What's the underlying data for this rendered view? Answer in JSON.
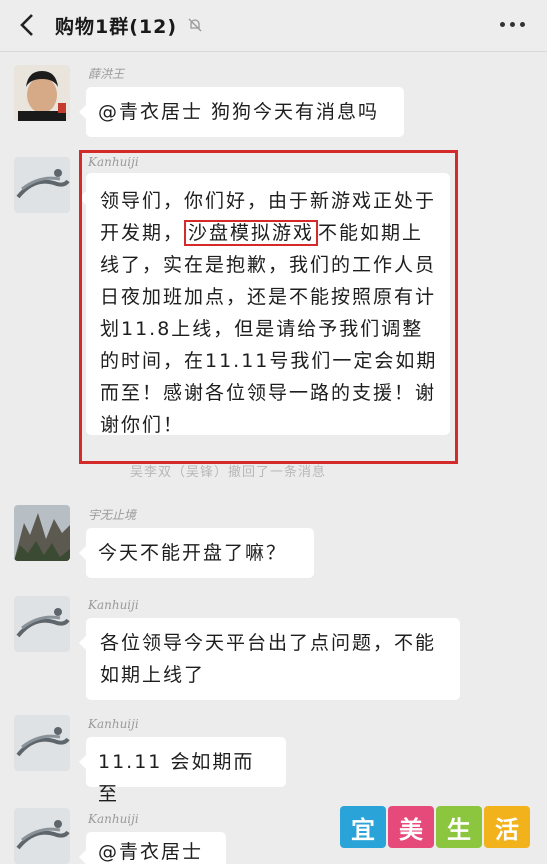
{
  "header": {
    "title": "购物1群(12)",
    "back_icon": "chevron-left-icon",
    "mute_icon": "bell-off-icon",
    "more_icon": "ellipsis-icon"
  },
  "messages": [
    {
      "sender": "薛洪王",
      "text": "@青衣居士 狗狗今天有消息吗"
    },
    {
      "sender": "Kanhuiji",
      "text_before": "领导们，你们好，由于新游戏正处于开发期，",
      "text_highlight": "沙盘模拟游戏",
      "text_after": "不能如期上线了，实在是抱歉，我们的工作人员日夜加班加点，还是不能按照原有计划11.8上线，但是请给予我们调整的时间，在11.11号我们一定会如期而至！感谢各位领导一路的支援！谢谢你们！"
    },
    {
      "system": "吴李双（吴锋）撤回了一条消息"
    },
    {
      "sender": "宇无止境",
      "text": "今天不能开盘了嘛？"
    },
    {
      "sender": "Kanhuiji",
      "text": "各位领导今天平台出了点问题，不能如期上线了"
    },
    {
      "sender": "Kanhuiji",
      "text": "11.11 会如期而至"
    },
    {
      "sender": "Kanhuiji",
      "text": "@青衣居士"
    }
  ],
  "watermark": [
    "宜",
    "美",
    "生",
    "活"
  ],
  "colors": {
    "highlight_red": "#d42a2a",
    "background": "#ececec",
    "bubble": "#ffffff"
  }
}
